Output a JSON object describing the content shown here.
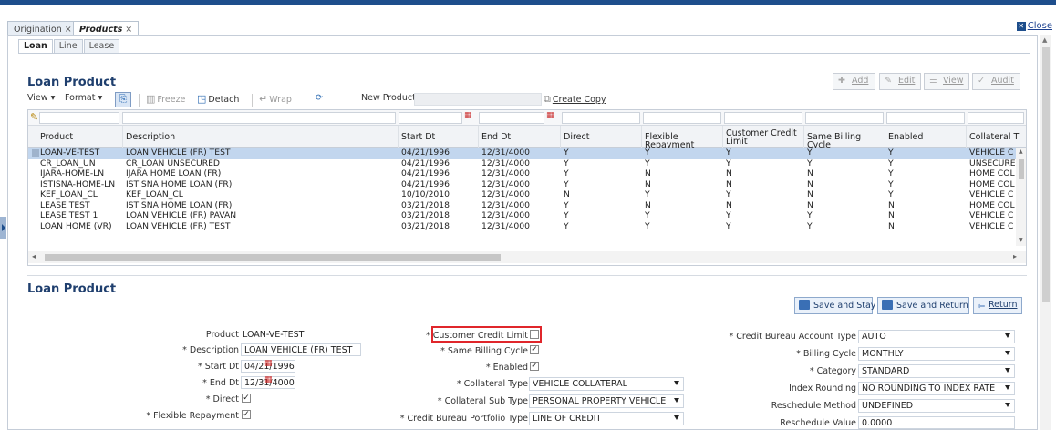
{
  "tabs": [
    {
      "label": "Origination",
      "close": "×"
    },
    {
      "label": "Products",
      "close": "×"
    }
  ],
  "close_label": "Close",
  "sub_tabs": [
    "Loan",
    "Line",
    "Lease"
  ],
  "grid_section": {
    "title": "Loan Product",
    "actions": [
      {
        "label": "Add",
        "icon": "add-icon"
      },
      {
        "label": "Edit",
        "icon": "pencil-icon"
      },
      {
        "label": "View",
        "icon": "list-icon"
      },
      {
        "label": "Audit",
        "icon": "check-icon"
      }
    ],
    "toolbar": {
      "view": "View",
      "format": "Format",
      "freeze": "Freeze",
      "detach": "Detach",
      "wrap": "Wrap",
      "new_product": "New Product",
      "create_copy": "Create Copy"
    },
    "columns": [
      "Product",
      "Description",
      "Start Dt",
      "End Dt",
      "Direct",
      "Flexible Repayment",
      "Customer Credit Limit",
      "Same Billing Cycle",
      "Enabled",
      "Collateral T"
    ],
    "rows": [
      [
        "LOAN-VE-TEST",
        "LOAN VEHICLE (FR) TEST",
        "04/21/1996",
        "12/31/4000",
        "Y",
        "Y",
        "Y",
        "Y",
        "Y",
        "VEHICLE C"
      ],
      [
        "CR_LOAN_UN",
        "CR_LOAN UNSECURED",
        "04/21/1996",
        "12/31/4000",
        "Y",
        "Y",
        "Y",
        "Y",
        "Y",
        "UNSECURE"
      ],
      [
        "IJARA-HOME-LN",
        "IJARA HOME LOAN (FR)",
        "04/21/1996",
        "12/31/4000",
        "Y",
        "N",
        "N",
        "N",
        "Y",
        "HOME COL"
      ],
      [
        "ISTISNA-HOME-LN",
        "ISTISNA HOME LOAN (FR)",
        "04/21/1996",
        "12/31/4000",
        "Y",
        "N",
        "N",
        "N",
        "Y",
        "HOME COL"
      ],
      [
        "KEF_LOAN_CL",
        "KEF_LOAN_CL",
        "10/10/2010",
        "12/31/4000",
        "N",
        "Y",
        "Y",
        "N",
        "Y",
        "VEHICLE C"
      ],
      [
        "LEASE TEST",
        "ISTISNA HOME LOAN (FR)",
        "03/21/2018",
        "12/31/4000",
        "Y",
        "N",
        "N",
        "N",
        "N",
        "HOME COL"
      ],
      [
        "LEASE TEST 1",
        "LOAN VEHICLE (FR) PAVAN",
        "03/21/2018",
        "12/31/4000",
        "Y",
        "Y",
        "Y",
        "Y",
        "N",
        "VEHICLE C"
      ],
      [
        "LOAN HOME (VR)",
        "LOAN VEHICLE (FR) TEST",
        "03/21/2018",
        "12/31/4000",
        "Y",
        "Y",
        "Y",
        "Y",
        "N",
        "VEHICLE C"
      ]
    ]
  },
  "form_section": {
    "title": "Loan Product",
    "buttons": {
      "save_stay": "Save and Stay",
      "save_return": "Save and Return",
      "return": "Return"
    },
    "left": {
      "product_label": "Product",
      "product_value": "LOAN-VE-TEST",
      "description_label": "* Description",
      "description_value": "LOAN VEHICLE (FR) TEST",
      "start_dt_label": "* Start Dt",
      "start_dt_value": "04/21/1996",
      "end_dt_label": "* End Dt",
      "end_dt_value": "12/31/4000",
      "direct_label": "* Direct",
      "flexible_label": "* Flexible Repayment"
    },
    "middle": {
      "ccl_label": "* Customer Credit Limit",
      "sbc_label": "* Same Billing Cycle",
      "enabled_label": "* Enabled",
      "collateral_type_label": "* Collateral Type",
      "collateral_type_value": "VEHICLE COLLATERAL",
      "collateral_sub_label": "* Collateral Sub Type",
      "collateral_sub_value": "PERSONAL PROPERTY VEHICLE",
      "cb_portfolio_label": "* Credit Bureau Portfolio Type",
      "cb_portfolio_value": "LINE OF CREDIT"
    },
    "right": {
      "cb_account_label": "* Credit Bureau Account Type",
      "cb_account_value": "AUTO",
      "billing_cycle_label": "* Billing Cycle",
      "billing_cycle_value": "MONTHLY",
      "category_label": "* Category",
      "category_value": "STANDARD",
      "index_rounding_label": "Index Rounding",
      "index_rounding_value": "NO ROUNDING TO INDEX RATE",
      "reschedule_method_label": "Reschedule Method",
      "reschedule_method_value": "UNDEFINED",
      "reschedule_value_label": "Reschedule Value",
      "reschedule_value_value": "0.0000"
    },
    "checks": {
      "direct": true,
      "flexible": true,
      "ccl": false,
      "sbc": true,
      "enabled": true
    }
  },
  "colors": {
    "accent": "#1e4e8c",
    "selection": "#c2d6ee",
    "highlight": "#e0262b"
  }
}
